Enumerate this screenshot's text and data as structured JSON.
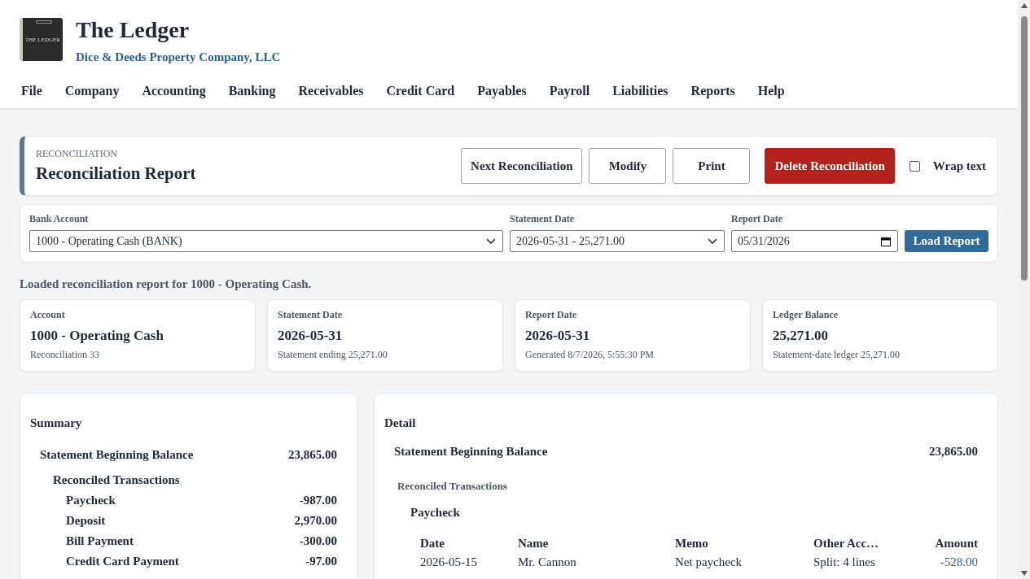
{
  "app": {
    "title": "The Ledger",
    "company": "Dice & Deeds Property Company, LLC",
    "logo_text": "THE LEDGER"
  },
  "menu": [
    "File",
    "Company",
    "Accounting",
    "Banking",
    "Receivables",
    "Credit Card",
    "Payables",
    "Payroll",
    "Liabilities",
    "Reports",
    "Help"
  ],
  "page": {
    "eyebrow": "RECONCILIATION",
    "title": "Reconciliation Report",
    "buttons": [
      {
        "label": "Next Reconciliation",
        "kind": "outline"
      },
      {
        "label": "Modify",
        "kind": "outline"
      },
      {
        "label": "Print",
        "kind": "outline"
      },
      {
        "label": "Delete Reconciliation",
        "kind": "danger"
      }
    ],
    "wrap_text": {
      "label": "Wrap text",
      "checked": false
    }
  },
  "filters": [
    {
      "label": "Bank Account",
      "value": "1000 - Operating Cash (BANK)",
      "kind": "select"
    },
    {
      "label": "Statement Date",
      "value": "2026-05-31 - 25,271.00",
      "kind": "select"
    },
    {
      "label": "Report Date",
      "value": "05/31/2026",
      "kind": "date"
    }
  ],
  "load_button": "Load Report",
  "status_message": "Loaded reconciliation report for 1000 - Operating Cash.",
  "stats": [
    {
      "label": "Account",
      "value": "1000 - Operating Cash",
      "note": "Reconciliation 33"
    },
    {
      "label": "Statement Date",
      "value": "2026-05-31",
      "note": "Statement ending 25,271.00"
    },
    {
      "label": "Report Date",
      "value": "2026-05-31",
      "note": "Generated 8/7/2026, 5:55:30 PM"
    },
    {
      "label": "Ledger Balance",
      "value": "25,271.00",
      "note": "Statement-date ledger 25,271.00"
    }
  ],
  "summary": {
    "title": "Summary",
    "beginning": {
      "label": "Statement Beginning Balance",
      "amount": "23,865.00"
    },
    "group": "Reconciled Transactions",
    "rows": [
      {
        "label": "Paycheck",
        "amount": "-987.00"
      },
      {
        "label": "Deposit",
        "amount": "2,970.00"
      },
      {
        "label": "Bill Payment",
        "amount": "-300.00"
      },
      {
        "label": "Credit Card Payment",
        "amount": "-97.00"
      }
    ]
  },
  "detail": {
    "title": "Detail",
    "beginning": {
      "label": "Statement Beginning Balance",
      "amount": "23,865.00"
    },
    "group": "Reconciled Transactions",
    "subgroup": "Paycheck",
    "columns": [
      "Date",
      "Name",
      "Memo",
      "Other Acc…",
      "Amount"
    ],
    "rows": [
      [
        "2026-05-15",
        "Mr. Cannon",
        "Net paycheck",
        "Split: 4 lines",
        "-528.00"
      ]
    ]
  }
}
